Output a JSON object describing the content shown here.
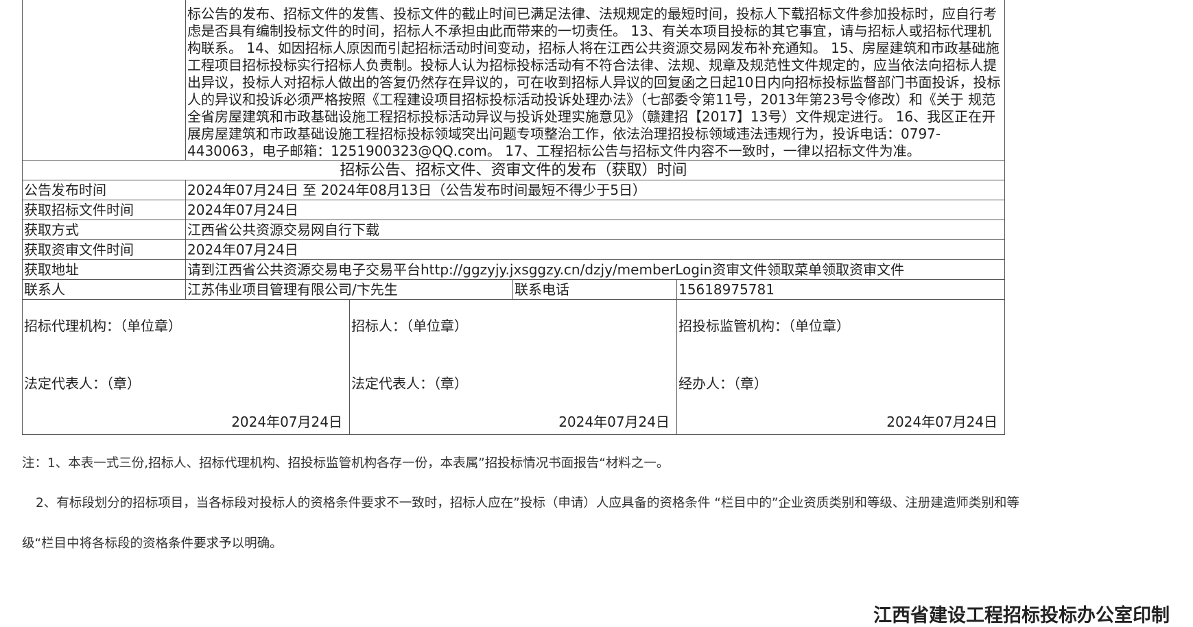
{
  "notes_text": "标公告的发布、招标文件的发售、投标文件的截止时间已满足法律、法规规定的最短时间，投标人下载招标文件参加投标时，应自行考虑是否具有编制投标文件的时间，招标人不承担由此而带来的一切责任。 13、有关本项目投标的其它事宜，请与招标人或招标代理机构联系。 14、如因招标人原因而引起招标活动时间变动，招标人将在江西公共资源交易网发布补充通知。 15、房屋建筑和市政基础施工程项目招标投标实行招标人负责制。投标人认为招标投标活动有不符合法律、法规、规章及规范性文件规定的，应当依法向招标人提出异议，投标人对招标人做出的答复仍然存在异议的，可在收到招标人异议的回复函之日起10日内向招标投标监督部门书面投诉，投标人的异议和投诉必须严格按照《工程建设项目招标投标活动投诉处理办法》（七部委令第11号，2013年第23号令修改）和《关于 规范全省房屋建筑和市政基础设施工程招标投标活动异议与投诉处理实施意见》（赣建招【2017】13号）文件规定进行。 16、我区正在开展房屋建筑和市政基础设施工程招标投标领域突出问题专项整治工作，依法治理招投标领域违法违规行为，投诉电话：0797-4430063，电子邮箱：1251900323@QQ.com。 17、工程招标公告与招标文件内容不一致时，一律以招标文件为准。",
  "section_title": "招标公告、招标文件、资审文件的发布（获取）时间",
  "rows": {
    "publish_label": "公告发布时间",
    "publish_value": "2024年07月24日 至 2024年08月13日（公告发布时间最短不得少于5日）",
    "get_doc_label": "获取招标文件时间",
    "get_doc_value": "2024年07月24日",
    "method_label": "获取方式",
    "method_value": "江西省公共资源交易网自行下载",
    "qual_time_label": "获取资审文件时间",
    "qual_time_value": "2024年07月24日",
    "address_label": "获取地址",
    "address_value": "请到江西省公共资源交易电子交易平台http://ggzyjy.jxsggzy.cn/dzjy/memberLogin资审文件领取菜单领取资审文件",
    "contact_label": "联系人",
    "contact_value": "江苏伟业项目管理有限公司/卞先生",
    "phone_label": "联系电话",
    "phone_value": "15618975781"
  },
  "signatures": {
    "agency_title": "招标代理机构：（单位章）",
    "agency_rep": "法定代表人：（章）",
    "agency_date": "2024年07月24日",
    "tenderer_title": "招标人：（单位章）",
    "tenderer_rep": "法定代表人：（章）",
    "tenderer_date": "2024年07月24日",
    "supervisor_title": "招投标监管机构：（单位章）",
    "supervisor_rep": "经办人：（章）",
    "supervisor_date": "2024年07月24日"
  },
  "footnotes": {
    "line1": "注：1、本表一式三份,招标人、招标代理机构、招投标监管机构各存一份，本表属”招投标情况书面报告“材料之一。",
    "line2": "2、有标段划分的招标项目，当各标段对投标人的资格条件要求不一致时，招标人应在”投标（申请）人应具备的资格条件 “栏目中的”企业资质类别和等级、注册建造师类别和等",
    "line3": "级“栏目中将各标段的资格条件要求予以明确。"
  },
  "office_print": "江西省建设工程招标投标办公室印制"
}
